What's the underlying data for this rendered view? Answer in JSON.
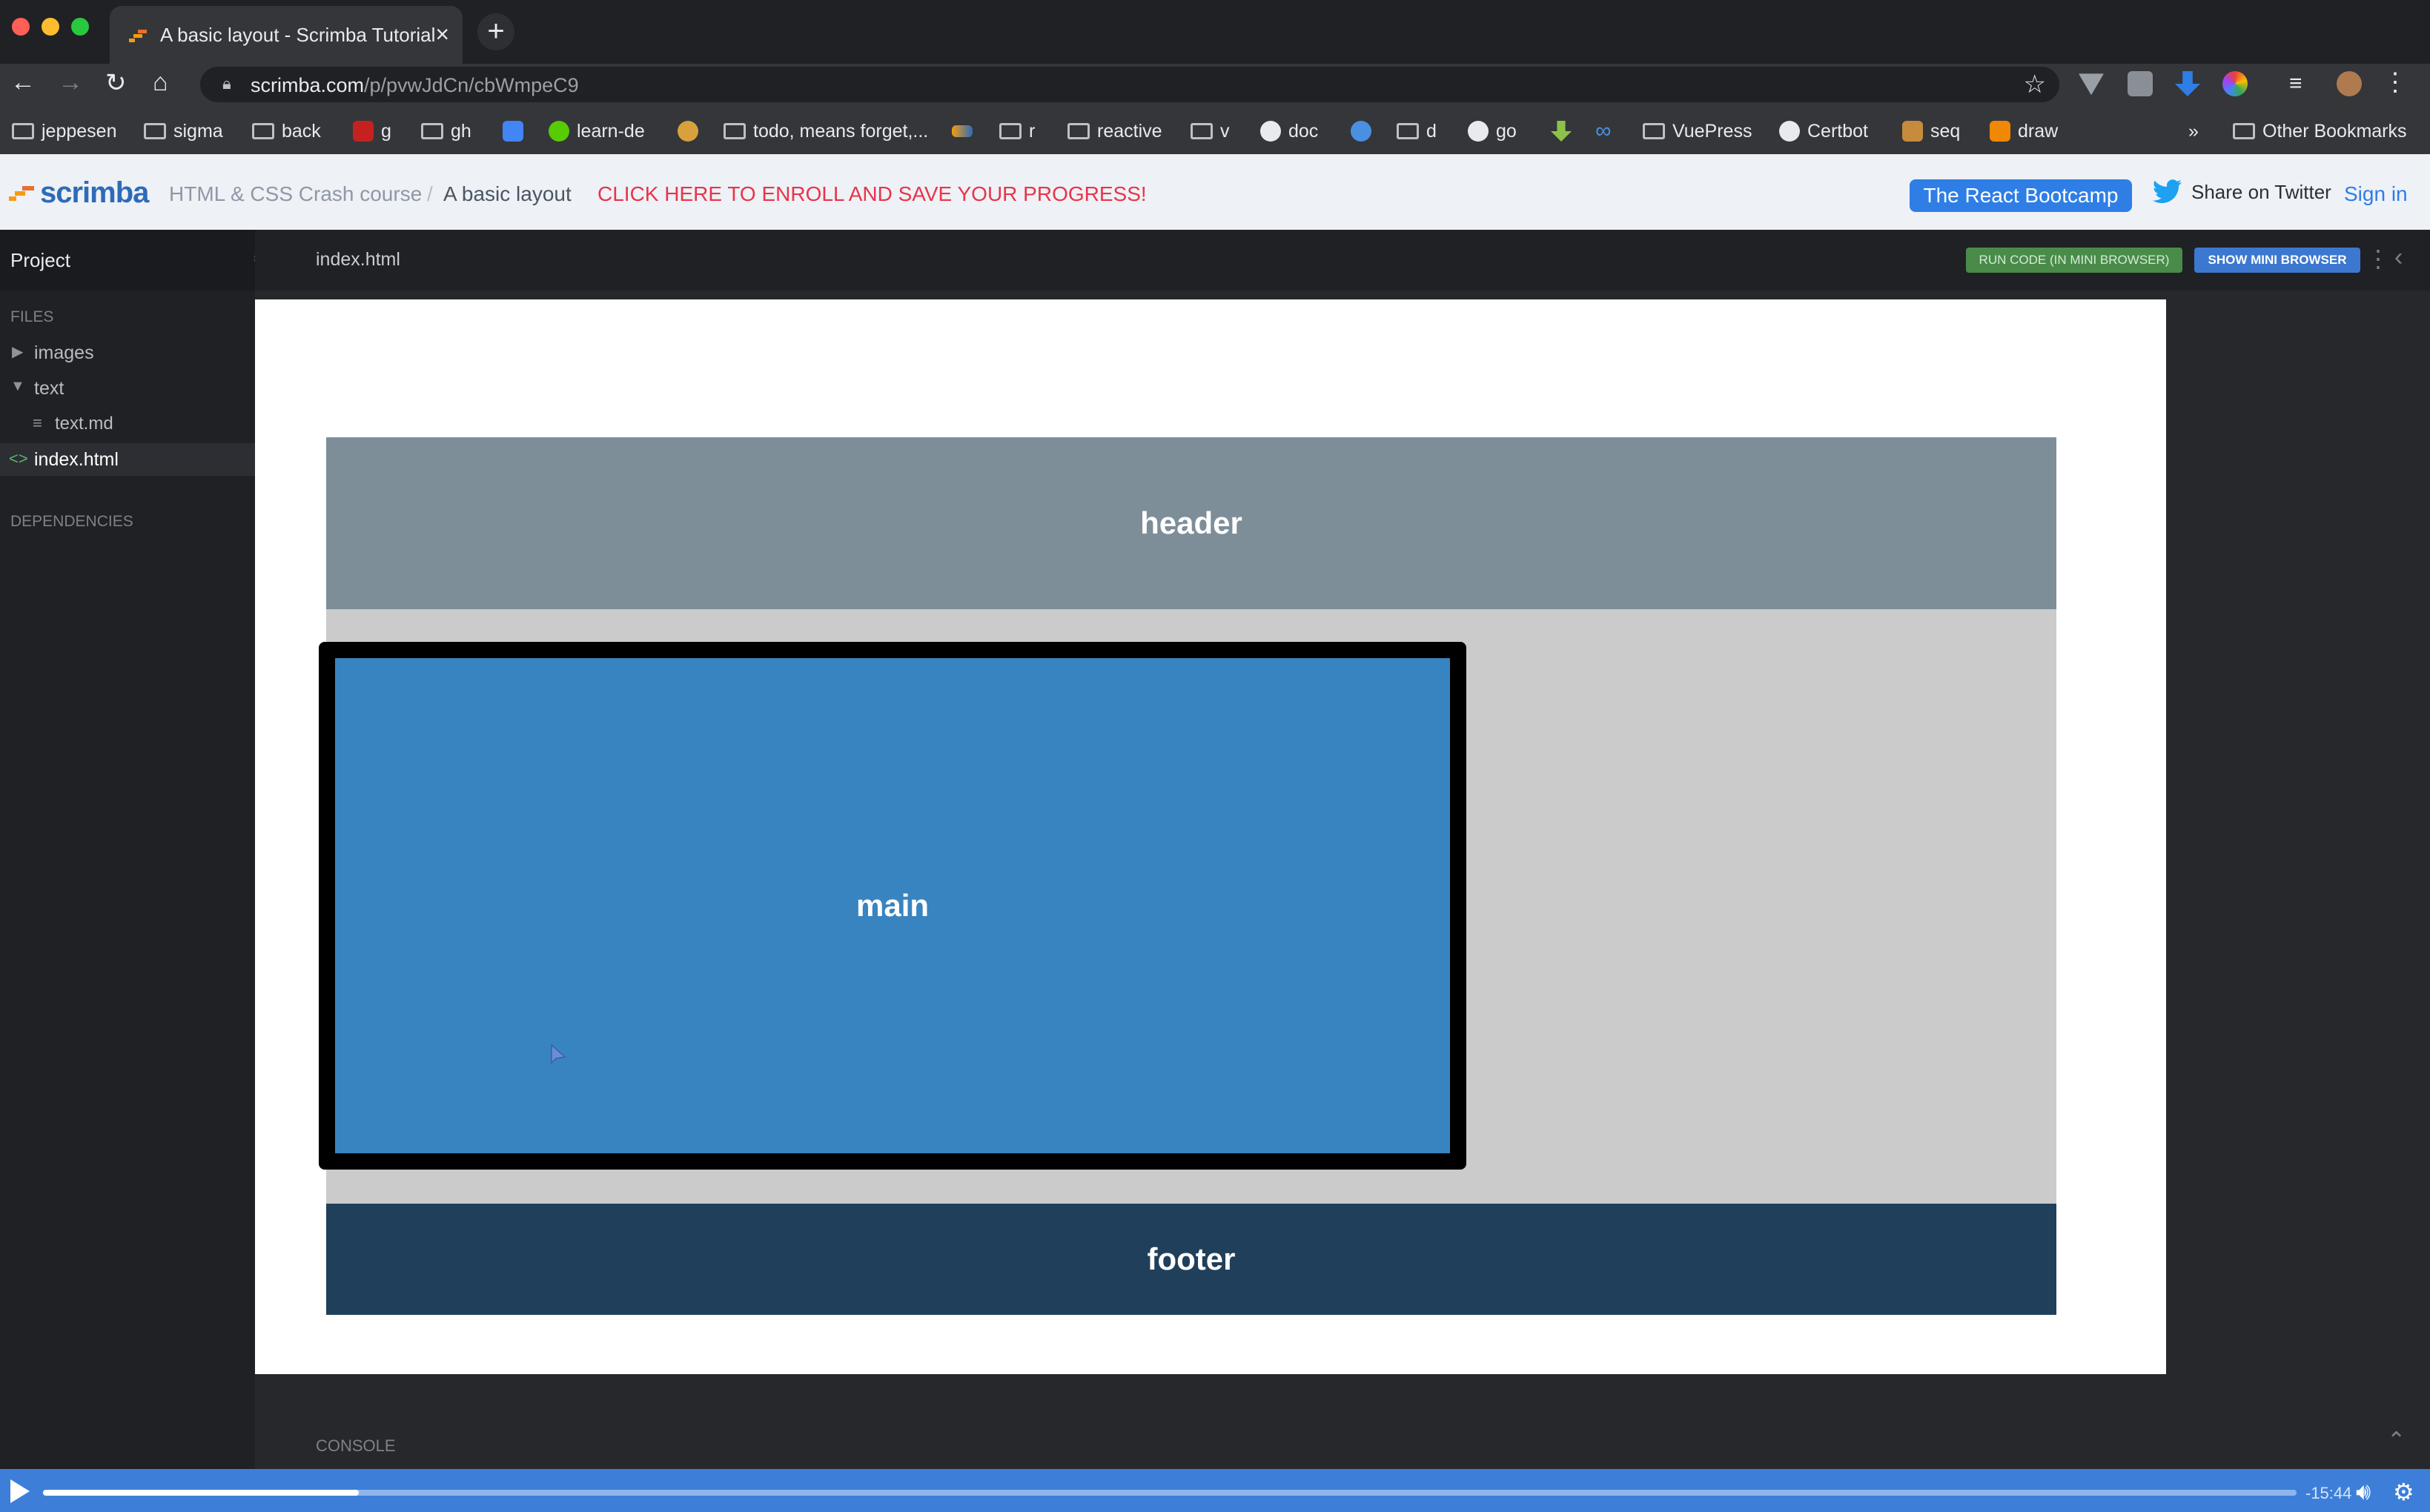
{
  "browser": {
    "tab_title": "A basic layout - Scrimba Tutorial",
    "url_host": "scrimba.com",
    "url_path": "/p/pvwJdCn/cbWmpeC9",
    "bookmarks": [
      "jeppesen",
      "sigma",
      "back",
      "g",
      "gh",
      "learn-de",
      "todo, means forget,...",
      "r",
      "reactive",
      "v",
      "doc",
      "d",
      "go",
      "VuePress",
      "Certbot",
      "seq",
      "draw"
    ],
    "bookmarks_overflow": "»",
    "other_bookmarks": "Other Bookmarks"
  },
  "scrimba": {
    "logo_text": "scrimba",
    "course": "HTML & CSS Crash course",
    "separator": "/",
    "lesson": "A basic layout",
    "enroll": "CLICK HERE TO ENROLL AND SAVE YOUR PROGRESS!",
    "bootcamp_button": "The React Bootcamp",
    "twitter": "Share on Twitter",
    "signin": "Sign in"
  },
  "sidebar": {
    "title": "Project",
    "files_label": "FILES",
    "items": [
      {
        "label": "images"
      },
      {
        "label": "text"
      },
      {
        "label": "text.md"
      },
      {
        "label": "index.html"
      }
    ],
    "dependencies_label": "DEPENDENCIES"
  },
  "editor": {
    "filename": "index.html",
    "run_code": "RUN CODE (IN MINI BROWSER)",
    "show_mini_browser": "SHOW MINI BROWSER"
  },
  "preview": {
    "header": "header",
    "main": "main",
    "footer": "footer"
  },
  "console": {
    "label": "CONSOLE"
  },
  "player": {
    "time_remaining": "-15:44",
    "progress_fraction": 0.14
  },
  "colors": {
    "accent": "#3d7fd8",
    "enroll": "#e8344a",
    "header_box": "#7d8e99",
    "main_box": "#3884c0",
    "footer_box": "#203f5b"
  }
}
